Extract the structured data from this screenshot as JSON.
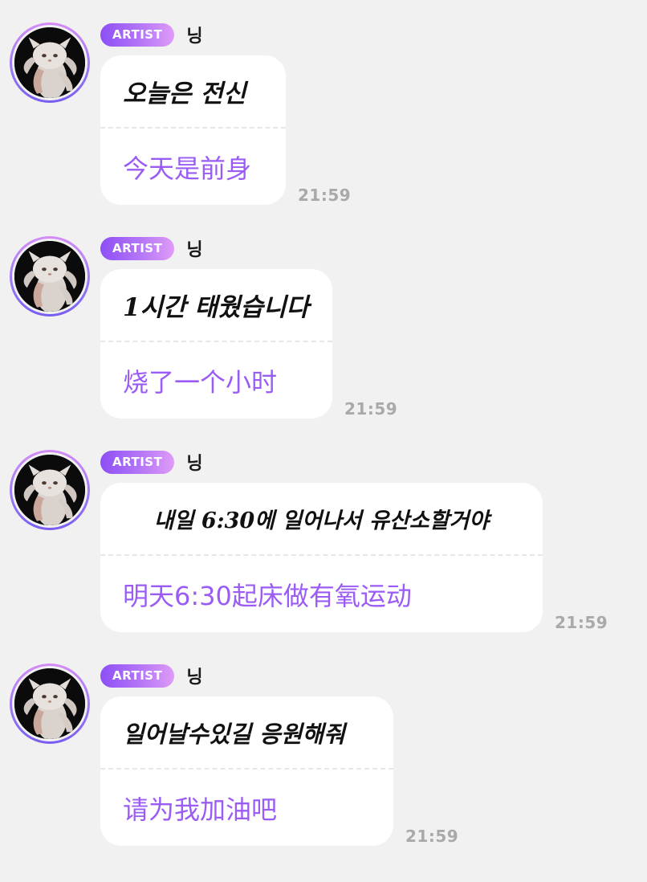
{
  "badge_label": "ARTIST",
  "sender_name": "닝",
  "messages": [
    {
      "korean": "오늘은 전신",
      "chinese": "今天是前身",
      "time": "21:59"
    },
    {
      "korean": "1시간 태웠습니다",
      "chinese": "烧了一个小时",
      "time": "21:59"
    },
    {
      "korean": "내일 6:30에 일어나서 유산소할거야",
      "chinese": "明天6:30起床做有氧运动",
      "time": "21:59"
    },
    {
      "korean": "일어날수있길 응원해줘",
      "chinese": "请为我加油吧",
      "time": "21:59"
    }
  ],
  "colors": {
    "background": "#f1f1f1",
    "bubble": "#ffffff",
    "translation_text": "#9a5cf4",
    "timestamp": "#a9a9a9",
    "badge_gradient_start": "#8d4ff5",
    "badge_gradient_end": "#de9bf7"
  }
}
